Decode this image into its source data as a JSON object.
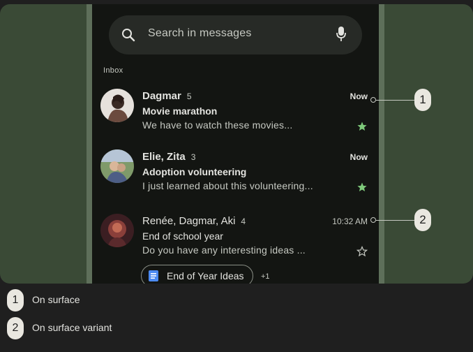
{
  "search": {
    "placeholder": "Search in messages"
  },
  "inbox_label": "Inbox",
  "emails": [
    {
      "sender": "Dagmar",
      "count": "5",
      "time": "Now",
      "subject": "Movie marathon",
      "preview": "We have to watch these movies...",
      "starred": true
    },
    {
      "sender": "Elie, Zita",
      "count": "3",
      "time": "Now",
      "subject": "Adoption volunteering",
      "preview": "I just learned about this volunteering...",
      "starred": true
    },
    {
      "sender": "Renée, Dagmar, Aki",
      "count": "4",
      "time": "10:32 AM",
      "subject": "End of school year",
      "preview": "Do you have any interesting ideas ...",
      "starred": false,
      "attachment": "End of Year Ideas",
      "extra": "+1"
    }
  ],
  "callouts": [
    "1",
    "2"
  ],
  "legend": [
    {
      "number": "1",
      "label": "On surface"
    },
    {
      "number": "2",
      "label": "On surface variant"
    }
  ],
  "colors": {
    "surface": "#131512",
    "background": "#3a4a36",
    "star_filled": "#7ec97a",
    "doc_icon": "#4c8af0"
  }
}
